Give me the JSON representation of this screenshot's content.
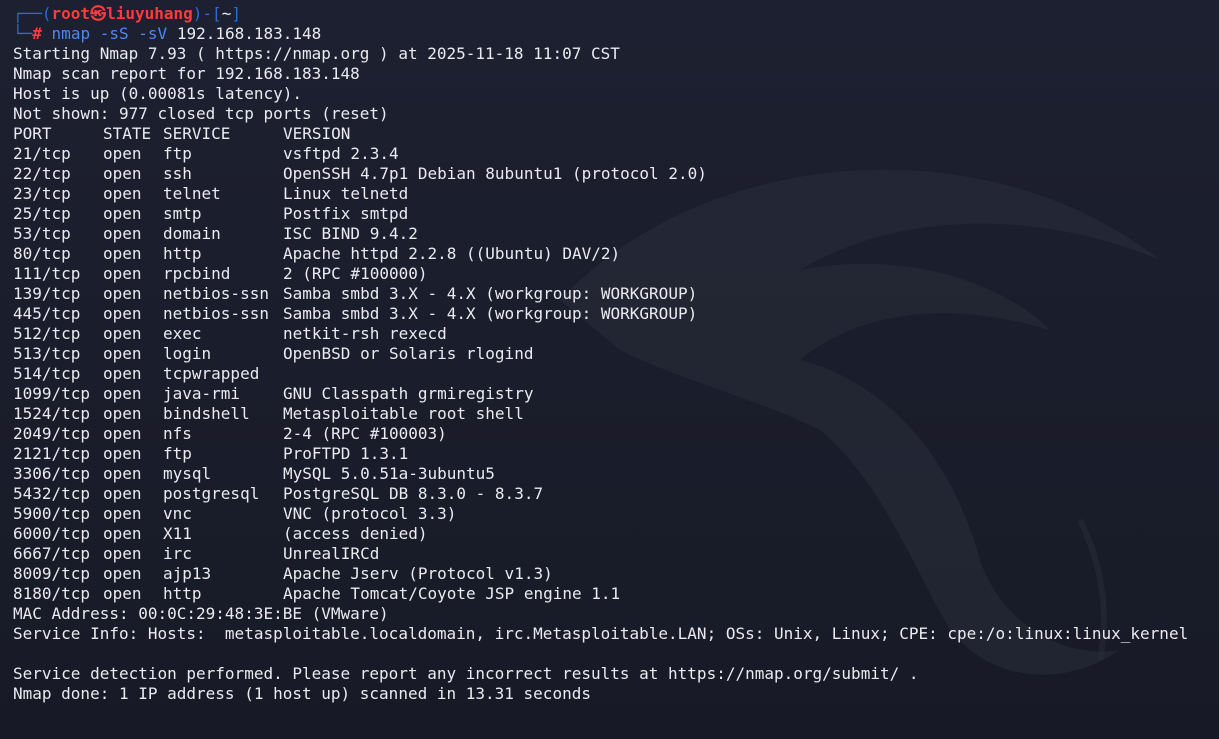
{
  "prompt": {
    "user": "root",
    "at_glyph": "㉿",
    "host": "liuyuhang",
    "dir": "~",
    "hash": "#"
  },
  "command": {
    "name": "nmap",
    "flag1": "-sS",
    "flag2": "-sV",
    "target": "192.168.183.148"
  },
  "output": {
    "start_line": "Starting Nmap 7.93 ( https://nmap.org ) at 2025-11-18 11:07 CST",
    "report_line": "Nmap scan report for 192.168.183.148",
    "host_up": "Host is up (0.00081s latency).",
    "not_shown": "Not shown: 977 closed tcp ports (reset)",
    "headers": [
      "PORT",
      "STATE",
      "SERVICE",
      "VERSION"
    ],
    "ports": [
      {
        "port": "21/tcp",
        "state": "open",
        "service": "ftp",
        "version": "vsftpd 2.3.4"
      },
      {
        "port": "22/tcp",
        "state": "open",
        "service": "ssh",
        "version": "OpenSSH 4.7p1 Debian 8ubuntu1 (protocol 2.0)"
      },
      {
        "port": "23/tcp",
        "state": "open",
        "service": "telnet",
        "version": "Linux telnetd"
      },
      {
        "port": "25/tcp",
        "state": "open",
        "service": "smtp",
        "version": "Postfix smtpd"
      },
      {
        "port": "53/tcp",
        "state": "open",
        "service": "domain",
        "version": "ISC BIND 9.4.2"
      },
      {
        "port": "80/tcp",
        "state": "open",
        "service": "http",
        "version": "Apache httpd 2.2.8 ((Ubuntu) DAV/2)"
      },
      {
        "port": "111/tcp",
        "state": "open",
        "service": "rpcbind",
        "version": "2 (RPC #100000)"
      },
      {
        "port": "139/tcp",
        "state": "open",
        "service": "netbios-ssn",
        "version": "Samba smbd 3.X - 4.X (workgroup: WORKGROUP)"
      },
      {
        "port": "445/tcp",
        "state": "open",
        "service": "netbios-ssn",
        "version": "Samba smbd 3.X - 4.X (workgroup: WORKGROUP)"
      },
      {
        "port": "512/tcp",
        "state": "open",
        "service": "exec",
        "version": "netkit-rsh rexecd"
      },
      {
        "port": "513/tcp",
        "state": "open",
        "service": "login",
        "version": "OpenBSD or Solaris rlogind"
      },
      {
        "port": "514/tcp",
        "state": "open",
        "service": "tcpwrapped",
        "version": ""
      },
      {
        "port": "1099/tcp",
        "state": "open",
        "service": "java-rmi",
        "version": "GNU Classpath grmiregistry"
      },
      {
        "port": "1524/tcp",
        "state": "open",
        "service": "bindshell",
        "version": "Metasploitable root shell"
      },
      {
        "port": "2049/tcp",
        "state": "open",
        "service": "nfs",
        "version": "2-4 (RPC #100003)"
      },
      {
        "port": "2121/tcp",
        "state": "open",
        "service": "ftp",
        "version": "ProFTPD 1.3.1"
      },
      {
        "port": "3306/tcp",
        "state": "open",
        "service": "mysql",
        "version": "MySQL 5.0.51a-3ubuntu5"
      },
      {
        "port": "5432/tcp",
        "state": "open",
        "service": "postgresql",
        "version": "PostgreSQL DB 8.3.0 - 8.3.7"
      },
      {
        "port": "5900/tcp",
        "state": "open",
        "service": "vnc",
        "version": "VNC (protocol 3.3)"
      },
      {
        "port": "6000/tcp",
        "state": "open",
        "service": "X11",
        "version": "(access denied)"
      },
      {
        "port": "6667/tcp",
        "state": "open",
        "service": "irc",
        "version": "UnrealIRCd"
      },
      {
        "port": "8009/tcp",
        "state": "open",
        "service": "ajp13",
        "version": "Apache Jserv (Protocol v1.3)"
      },
      {
        "port": "8180/tcp",
        "state": "open",
        "service": "http",
        "version": "Apache Tomcat/Coyote JSP engine 1.1"
      }
    ],
    "mac_line": "MAC Address: 00:0C:29:48:3E:BE (VMware)",
    "service_info": "Service Info: Hosts:  metasploitable.localdomain, irc.Metasploitable.LAN; OSs: Unix, Linux; CPE: cpe:/o:linux:linux_kernel",
    "blank": "",
    "detection_line": "Service detection performed. Please report any incorrect results at https://nmap.org/submit/ .",
    "done_line": "Nmap done: 1 IP address (1 host up) scanned in 13.31 seconds"
  },
  "colors": {
    "background": "#1b1e29",
    "text": "#eaeaf0",
    "prompt_frame": "#2b6bd8",
    "prompt_user": "#ff3b3b",
    "command": "#4c89f0"
  }
}
